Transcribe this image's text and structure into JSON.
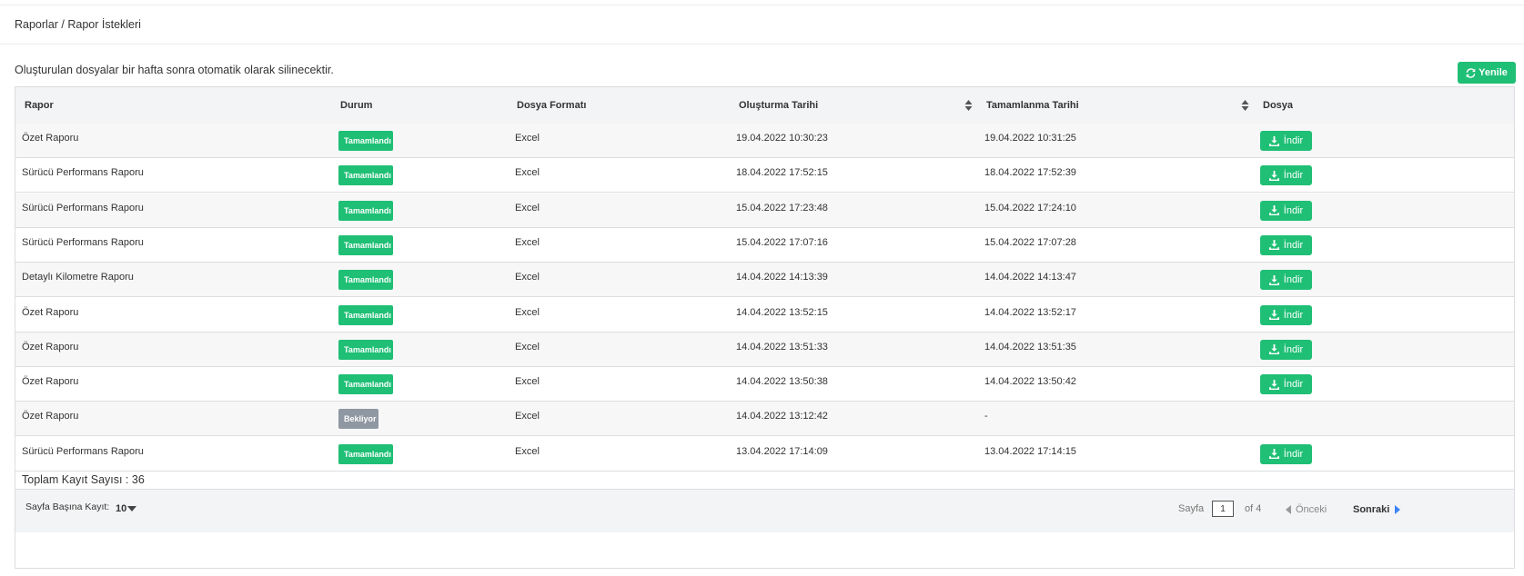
{
  "breadcrumb": "Raporlar / Rapor İstekleri",
  "notice": "Oluşturulan dosyalar bir hafta sonra otomatik olarak silinecektir.",
  "refresh_label": "Yenile",
  "columns": {
    "report": "Rapor",
    "status": "Durum",
    "format": "Dosya Formatı",
    "created": "Oluşturma Tarihi",
    "completed": "Tamamlanma Tarihi",
    "file": "Dosya"
  },
  "rows": [
    {
      "report": "Özet Raporu",
      "status": "Tamamlandı",
      "format": "Excel",
      "created": "19.04.2022 10:30:23",
      "completed": "19.04.2022 10:31:25",
      "download": "İndir"
    },
    {
      "report": "Sürücü Performans Raporu",
      "status": "Tamamlandı",
      "format": "Excel",
      "created": "18.04.2022 17:52:15",
      "completed": "18.04.2022 17:52:39",
      "download": "İndir"
    },
    {
      "report": "Sürücü Performans Raporu",
      "status": "Tamamlandı",
      "format": "Excel",
      "created": "15.04.2022 17:23:48",
      "completed": "15.04.2022 17:24:10",
      "download": "İndir"
    },
    {
      "report": "Sürücü Performans Raporu",
      "status": "Tamamlandı",
      "format": "Excel",
      "created": "15.04.2022 17:07:16",
      "completed": "15.04.2022 17:07:28",
      "download": "İndir"
    },
    {
      "report": "Detaylı Kilometre Raporu",
      "status": "Tamamlandı",
      "format": "Excel",
      "created": "14.04.2022 14:13:39",
      "completed": "14.04.2022 14:13:47",
      "download": "İndir"
    },
    {
      "report": "Özet Raporu",
      "status": "Tamamlandı",
      "format": "Excel",
      "created": "14.04.2022 13:52:15",
      "completed": "14.04.2022 13:52:17",
      "download": "İndir"
    },
    {
      "report": "Özet Raporu",
      "status": "Tamamlandı",
      "format": "Excel",
      "created": "14.04.2022 13:51:33",
      "completed": "14.04.2022 13:51:35",
      "download": "İndir"
    },
    {
      "report": "Özet Raporu",
      "status": "Tamamlandı",
      "format": "Excel",
      "created": "14.04.2022 13:50:38",
      "completed": "14.04.2022 13:50:42",
      "download": "İndir"
    },
    {
      "report": "Özet Raporu",
      "status": "Bekliyor",
      "format": "Excel",
      "created": "14.04.2022 13:12:42",
      "completed": "-",
      "download": ""
    },
    {
      "report": "Sürücü Performans Raporu",
      "status": "Tamamlandı",
      "format": "Excel",
      "created": "13.04.2022 17:14:09",
      "completed": "13.04.2022 17:14:15",
      "download": "İndir"
    }
  ],
  "total_records": "Toplam Kayıt Sayısı : 36",
  "pagination": {
    "per_page_label": "Sayfa Başına Kayıt:",
    "per_page_value": "10",
    "page_label": "Sayfa",
    "current_page": "1",
    "of_pages": "of 4",
    "prev_label": "Önceki",
    "next_label": "Sonraki"
  },
  "colors": {
    "success": "#1fbf75",
    "pending": "#8e97a2",
    "header_bg": "#f3f4f5"
  },
  "icons": {
    "refresh": "refresh-icon",
    "download": "download-icon",
    "sort": "sort-icon",
    "dropdown": "caret-down-icon",
    "prev": "caret-left-icon",
    "next": "caret-right-icon"
  }
}
